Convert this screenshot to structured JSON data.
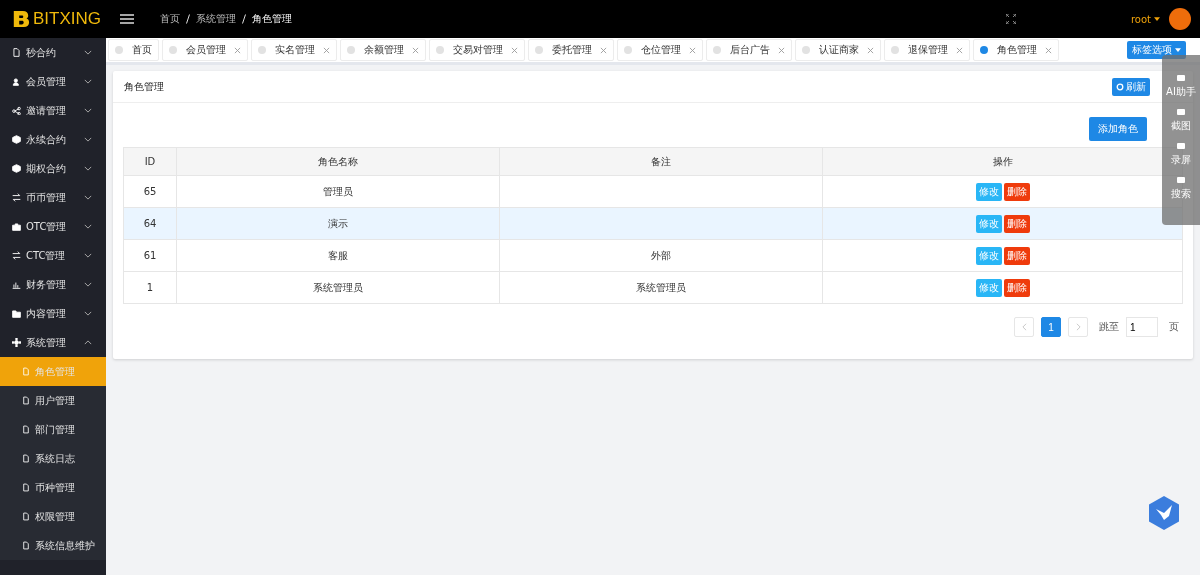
{
  "header": {
    "logo": "BITXING",
    "breadcrumb": [
      "首页",
      "系统管理",
      "角色管理"
    ],
    "user": "root"
  },
  "sidebar": {
    "items": [
      {
        "label": "秒合约",
        "expanded": false
      },
      {
        "label": "会员管理",
        "expanded": false
      },
      {
        "label": "邀请管理",
        "expanded": false
      },
      {
        "label": "永续合约",
        "expanded": false
      },
      {
        "label": "期权合约",
        "expanded": false
      },
      {
        "label": "币币管理",
        "expanded": false
      },
      {
        "label": "OTC管理",
        "expanded": false
      },
      {
        "label": "CTC管理",
        "expanded": false
      },
      {
        "label": "财务管理",
        "expanded": false
      },
      {
        "label": "内容管理",
        "expanded": false
      },
      {
        "label": "系统管理",
        "expanded": true,
        "children": [
          {
            "label": "角色管理",
            "selected": true
          },
          {
            "label": "用户管理",
            "selected": false
          },
          {
            "label": "部门管理",
            "selected": false
          },
          {
            "label": "系统日志",
            "selected": false
          },
          {
            "label": "币种管理",
            "selected": false
          },
          {
            "label": "权限管理",
            "selected": false
          },
          {
            "label": "系统信息维护",
            "selected": false
          }
        ]
      }
    ]
  },
  "tabs": [
    {
      "label": "首页",
      "selected": false,
      "closable": false
    },
    {
      "label": "会员管理",
      "selected": false,
      "closable": true
    },
    {
      "label": "实名管理",
      "selected": false,
      "closable": true
    },
    {
      "label": "余额管理",
      "selected": false,
      "closable": true
    },
    {
      "label": "交易对管理",
      "selected": false,
      "closable": true
    },
    {
      "label": "委托管理",
      "selected": false,
      "closable": true
    },
    {
      "label": "仓位管理",
      "selected": false,
      "closable": true
    },
    {
      "label": "后台广告",
      "selected": false,
      "closable": true
    },
    {
      "label": "认证商家",
      "selected": false,
      "closable": true
    },
    {
      "label": "退保管理",
      "selected": false,
      "closable": true
    },
    {
      "label": "角色管理",
      "selected": true,
      "closable": true
    }
  ],
  "tab_options": "标签选项",
  "card": {
    "title": "角色管理",
    "refresh": "刷新",
    "add_button": "添加角色"
  },
  "table": {
    "columns": [
      "ID",
      "角色名称",
      "备注",
      "操作"
    ],
    "rows": [
      {
        "id": "65",
        "name": "管理员",
        "note": "",
        "hover": false,
        "actions": [
          "修改",
          "删除"
        ]
      },
      {
        "id": "64",
        "name": "演示",
        "note": "",
        "hover": true,
        "actions": [
          "修改",
          "删除"
        ]
      },
      {
        "id": "61",
        "name": "客服",
        "note": "外部",
        "hover": false,
        "actions": [
          "修改",
          "删除"
        ]
      },
      {
        "id": "1",
        "name": "系统管理员",
        "note": "系统管理员",
        "hover": false,
        "actions": [
          "修改",
          "删除"
        ]
      }
    ]
  },
  "pagination": {
    "pages": [
      {
        "label": "1",
        "selected": true
      }
    ],
    "jump_label": "跳至",
    "page_value": "1",
    "page_suffix": "页"
  },
  "floating_toolbar": {
    "items": [
      "AI助手",
      "截图",
      "录屏",
      "搜索"
    ]
  }
}
